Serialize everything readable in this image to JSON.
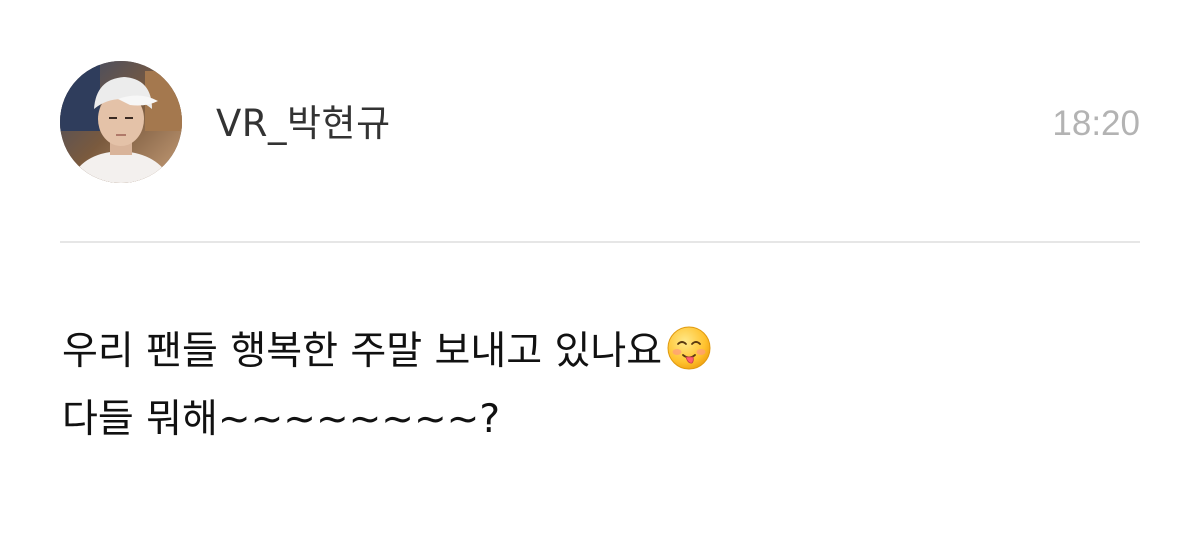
{
  "post": {
    "author_name": "VR_박현규",
    "time": "18:20",
    "message_line_1": "우리 팬들 행복한 주말 보내고 있나요",
    "message_line_2": "다들 뭐해~~~~~~~~?",
    "emoji": "savoring-face-icon"
  },
  "colors": {
    "name": "#333333",
    "time": "#b3b3b3",
    "divider": "#e6e6e6",
    "text": "#111111"
  }
}
